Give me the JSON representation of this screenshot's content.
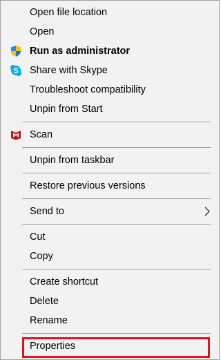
{
  "menu": {
    "items": [
      {
        "id": "open-file-location",
        "label": "Open file location"
      },
      {
        "id": "open",
        "label": "Open"
      },
      {
        "id": "run-as-admin",
        "label": "Run as administrator",
        "icon": "uac-shield-icon",
        "bold": true
      },
      {
        "id": "share-skype",
        "label": "Share with Skype",
        "icon": "skype-icon"
      },
      {
        "id": "troubleshoot",
        "label": "Troubleshoot compatibility"
      },
      {
        "id": "unpin-start",
        "label": "Unpin from Start"
      },
      {
        "id": "scan",
        "label": "Scan",
        "icon": "mcafee-icon"
      },
      {
        "id": "unpin-taskbar",
        "label": "Unpin from taskbar"
      },
      {
        "id": "restore-versions",
        "label": "Restore previous versions"
      },
      {
        "id": "send-to",
        "label": "Send to",
        "submenu": true
      },
      {
        "id": "cut",
        "label": "Cut"
      },
      {
        "id": "copy",
        "label": "Copy"
      },
      {
        "id": "create-shortcut",
        "label": "Create shortcut"
      },
      {
        "id": "delete",
        "label": "Delete"
      },
      {
        "id": "rename",
        "label": "Rename"
      },
      {
        "id": "properties",
        "label": "Properties",
        "highlighted": true
      }
    ]
  },
  "colors": {
    "menu_background": "#f2f2f2",
    "separator": "#a0a0a0",
    "highlight_border": "#e8101e",
    "skype_blue": "#00aff0",
    "mcafee_red": "#c01818",
    "shield_blue": "#1f6fd1",
    "shield_yellow": "#f5c400"
  }
}
